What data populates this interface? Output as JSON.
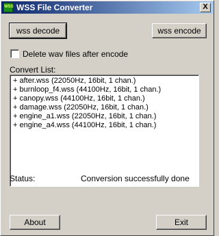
{
  "window": {
    "title": "WSS File Converter",
    "icon": "wss-app-icon",
    "close_label": "X"
  },
  "buttons": {
    "decode_label": "wss decode",
    "encode_label": "wss encode",
    "about_label": "About",
    "exit_label": "Exit"
  },
  "options": {
    "delete_wav_label": "Delete wav files after encode",
    "delete_wav_checked": false
  },
  "convert_list": {
    "label": "Convert List:",
    "items": [
      "+ after.wss  (22050Hz, 16bit, 1 chan.)",
      "+ burnloop_f4.wss  (44100Hz, 16bit, 1 chan.)",
      "+ canopy.wss  (44100Hz, 16bit, 1 chan.)",
      "+ damage.wss  (22050Hz, 16bit, 1 chan.)",
      "+ engine_a1.wss  (22050Hz, 16bit, 1 chan.)",
      "+ engine_a4.wss  (44100Hz, 16bit, 1 chan.)"
    ]
  },
  "status": {
    "label": "Status:",
    "value": "Conversion successfully done"
  }
}
